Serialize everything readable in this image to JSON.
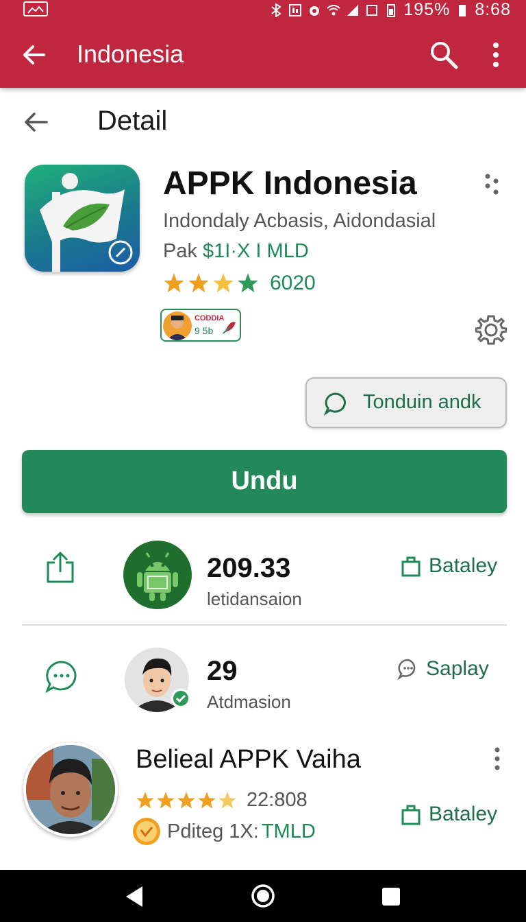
{
  "status_bar": {
    "battery_percent": "195%",
    "time": "8:68"
  },
  "app_bar": {
    "title": "Indonesia",
    "back_icon": "arrow-left-icon",
    "search_icon": "search-icon",
    "more_icon": "more-vert-icon"
  },
  "detail": {
    "title": "Detail"
  },
  "app": {
    "name": "APPK Indonesia",
    "subtitle": "Indondaly Acbasis, Aidondasial",
    "price_prefix": "Pak",
    "price": "$1I·X I MLD",
    "rating": "6020",
    "badge_line1": "CODDIA",
    "badge_line2": "9 5b",
    "stars": 4
  },
  "chat_button": {
    "label": "Tonduin andk"
  },
  "install_button": {
    "label": "Undu"
  },
  "stats": [
    {
      "number": "209.33",
      "label": "letidansaion",
      "link": "Bataley"
    },
    {
      "number": "29",
      "label": "Atdmasion",
      "link": "Saplay"
    }
  ],
  "review": {
    "title": "Belieal APPK Vaiha",
    "count": "22:808",
    "meta_prefix": "Pditeg 1X:",
    "meta_price": "TMLD",
    "link": "Bataley",
    "stars": 5
  },
  "colors": {
    "app_bar": "#c0263e",
    "accent_green": "#23885a",
    "star_orange": "#f0a020",
    "star_green": "#2e9a5a"
  }
}
